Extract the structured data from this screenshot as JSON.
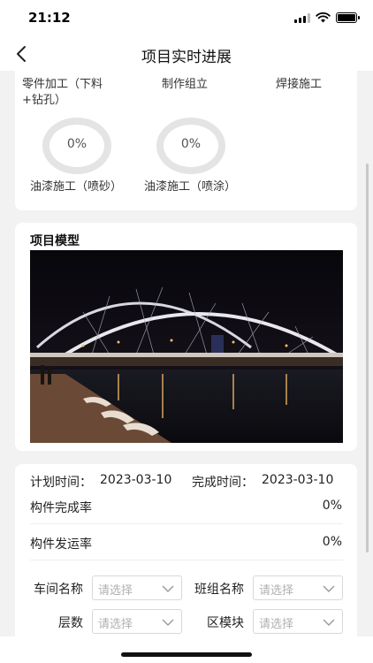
{
  "status_bar": {
    "time": "21:12"
  },
  "header": {
    "title": "项目实时进展"
  },
  "progress": {
    "processes": [
      {
        "label": "零件加工（下料+钻孔）"
      },
      {
        "label": "制作组立"
      },
      {
        "label": "焊接施工"
      },
      {
        "label": "油漆施工（喷砂）",
        "value": "0%"
      },
      {
        "label": "油漆施工（喷涂）",
        "value": "0%"
      }
    ]
  },
  "model": {
    "title": "项目模型",
    "image_alt": "bridge-night-photo"
  },
  "details": {
    "plan_time_label": "计划时间：",
    "plan_time_value": "2023-03-10",
    "finish_time_label": "完成时间：",
    "finish_time_value": "2023-03-10",
    "component_completion_label": "构件完成率",
    "component_completion_value": "0%",
    "component_shipping_label": "构件发运率",
    "component_shipping_value": "0%"
  },
  "filters": {
    "workshop_label": "车间名称",
    "team_label": "班组名称",
    "floor_label": "层数",
    "block_label": "区模块",
    "placeholder": "请选择"
  },
  "colors": {
    "ring": "#e4e4e4",
    "accent": "#222222"
  },
  "icons": {
    "back": "chevron-left-icon",
    "dropdown": "chevron-down-icon"
  }
}
